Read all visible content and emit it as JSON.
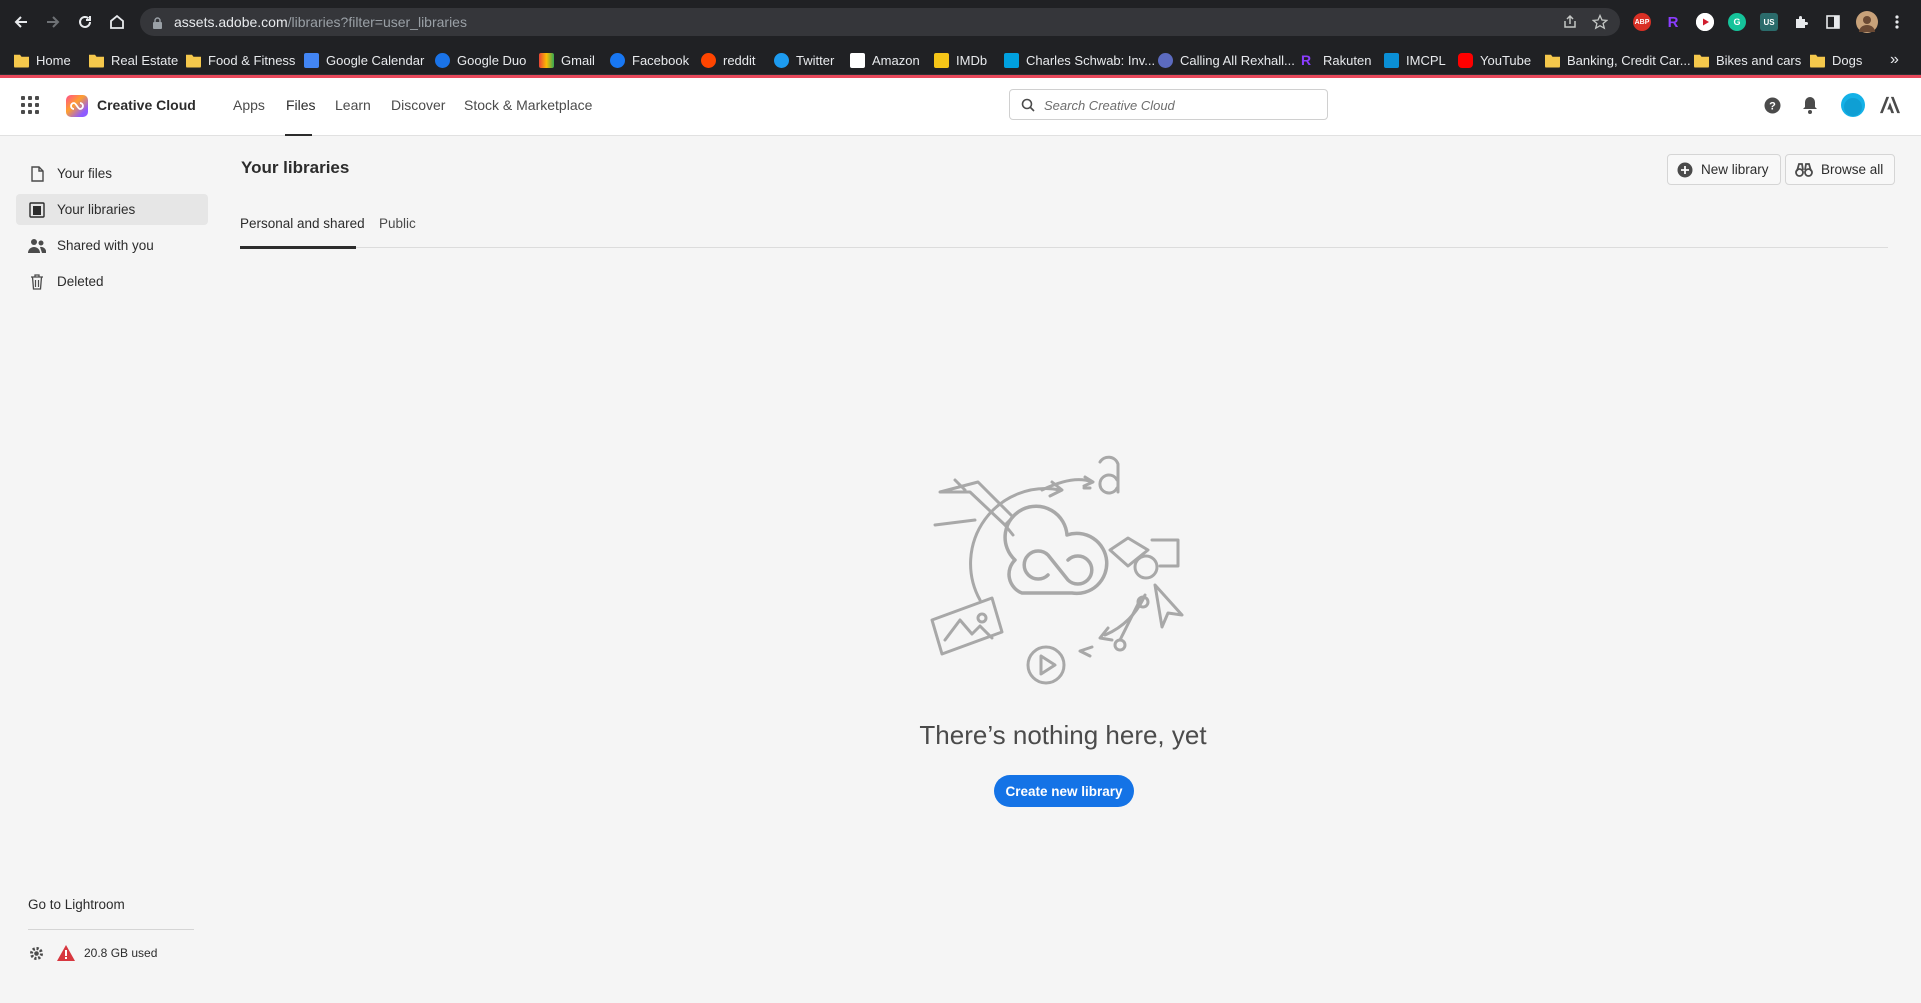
{
  "browser": {
    "url_host": "assets.adobe.com",
    "url_path": "/libraries?filter=user_libraries",
    "bookmarks": [
      {
        "label": "Home",
        "icon": "folder-icon"
      },
      {
        "label": "Real Estate",
        "icon": "folder-icon"
      },
      {
        "label": "Food & Fitness",
        "icon": "folder-icon"
      },
      {
        "label": "Google Calendar",
        "icon": "google-calendar-icon"
      },
      {
        "label": "Google Duo",
        "icon": "google-duo-icon"
      },
      {
        "label": "Gmail",
        "icon": "gmail-icon"
      },
      {
        "label": "Facebook",
        "icon": "facebook-icon"
      },
      {
        "label": "reddit",
        "icon": "reddit-icon"
      },
      {
        "label": "Twitter",
        "icon": "twitter-icon"
      },
      {
        "label": "Amazon",
        "icon": "amazon-icon"
      },
      {
        "label": "IMDb",
        "icon": "imdb-icon"
      },
      {
        "label": "Charles Schwab: Inv...",
        "icon": "schwab-icon"
      },
      {
        "label": "Calling All Rexhall...",
        "icon": "rexhall-icon"
      },
      {
        "label": "Rakuten",
        "icon": "rakuten-icon"
      },
      {
        "label": "IMCPL",
        "icon": "imcpl-icon"
      },
      {
        "label": "YouTube",
        "icon": "youtube-icon"
      },
      {
        "label": "Banking, Credit Car...",
        "icon": "folder-icon"
      },
      {
        "label": "Bikes and cars",
        "icon": "folder-icon"
      },
      {
        "label": "Dogs",
        "icon": "folder-icon"
      }
    ],
    "overflow_label": "»"
  },
  "header": {
    "brand": "Creative Cloud",
    "nav": [
      "Apps",
      "Files",
      "Learn",
      "Discover",
      "Stock & Marketplace"
    ],
    "active_nav": "Files",
    "search_placeholder": "Search Creative Cloud"
  },
  "sidebar": {
    "items": [
      {
        "label": "Your files",
        "icon": "file-icon"
      },
      {
        "label": "Your libraries",
        "icon": "library-icon",
        "active": true
      },
      {
        "label": "Shared with you",
        "icon": "people-icon"
      },
      {
        "label": "Deleted",
        "icon": "trash-icon"
      }
    ],
    "go_lightroom": "Go to Lightroom",
    "storage": "20.8 GB used"
  },
  "main": {
    "title": "Your libraries",
    "new_library_label": "New library",
    "browse_all_label": "Browse all",
    "tabs": [
      {
        "label": "Personal and shared",
        "active": true
      },
      {
        "label": "Public",
        "active": false
      }
    ],
    "empty_title": "There’s nothing here, yet",
    "create_label": "Create new library"
  },
  "colors": {
    "accent_blue": "#1473e6",
    "adobe_red": "#e8485b",
    "chrome_dark": "#202124"
  }
}
